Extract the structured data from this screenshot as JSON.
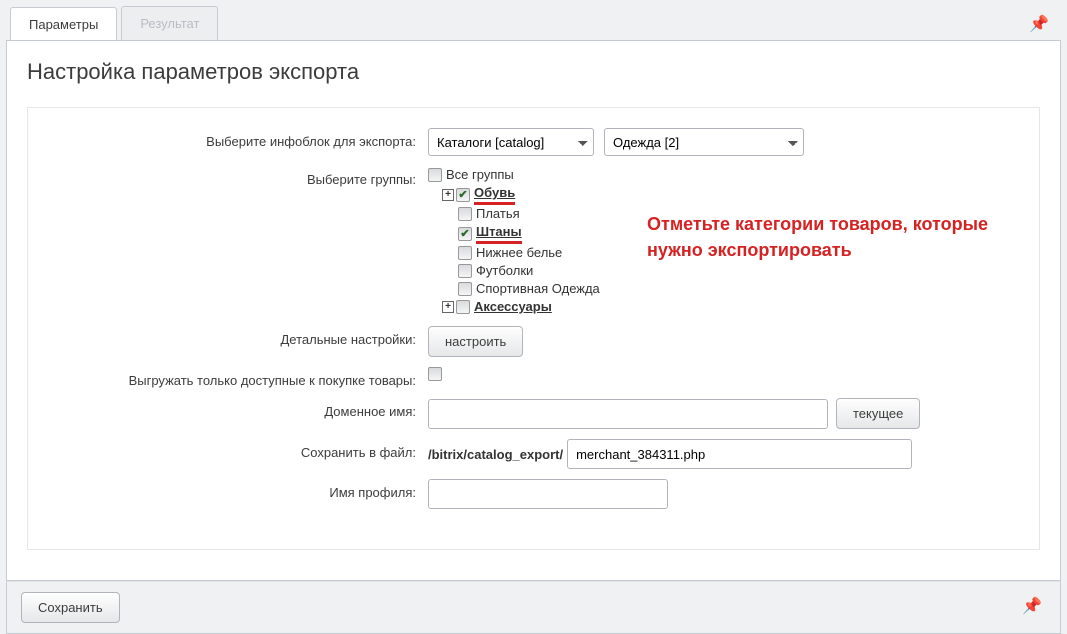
{
  "tabs": {
    "params": "Параметры",
    "result": "Результат"
  },
  "panel": {
    "title": "Настройка параметров экспорта"
  },
  "labels": {
    "iblock": "Выберите инфоблок для экспорта:",
    "groups": "Выберите группы:",
    "details": "Детальные настройки:",
    "available_only": "Выгружать только доступные к покупке товары:",
    "domain": "Доменное имя:",
    "save_to": "Сохранить в файл:",
    "profile_name": "Имя профиля:"
  },
  "selects": {
    "catalog": {
      "value": "Каталоги [catalog]"
    },
    "item": {
      "value": "Одежда [2]"
    }
  },
  "tree": {
    "all": "Все группы",
    "items": [
      {
        "label": "Обувь",
        "checked": true,
        "expandable": true,
        "bold": true,
        "underline_red": true
      },
      {
        "label": "Платья",
        "checked": false,
        "expandable": false,
        "bold": false,
        "underline_red": false
      },
      {
        "label": "Штаны",
        "checked": true,
        "expandable": false,
        "bold": true,
        "underline_red": true
      },
      {
        "label": "Нижнее белье",
        "checked": false,
        "expandable": false,
        "bold": false,
        "underline_red": false
      },
      {
        "label": "Футболки",
        "checked": false,
        "expandable": false,
        "bold": false,
        "underline_red": false
      },
      {
        "label": "Спортивная Одежда",
        "checked": false,
        "expandable": false,
        "bold": false,
        "underline_red": false
      },
      {
        "label": "Аксессуары",
        "checked": false,
        "expandable": true,
        "bold": true,
        "underline_red": false
      }
    ]
  },
  "buttons": {
    "configure": "настроить",
    "current": "текущее",
    "save": "Сохранить"
  },
  "fields": {
    "domain_value": "",
    "path_prefix": "/bitrix/catalog_export/",
    "file_value": "merchant_384311.php",
    "profile_value": ""
  },
  "annotation": "Отметьте категории товаров, которые нужно экспортировать",
  "icons": {
    "pin": "📌",
    "plus": "+"
  }
}
